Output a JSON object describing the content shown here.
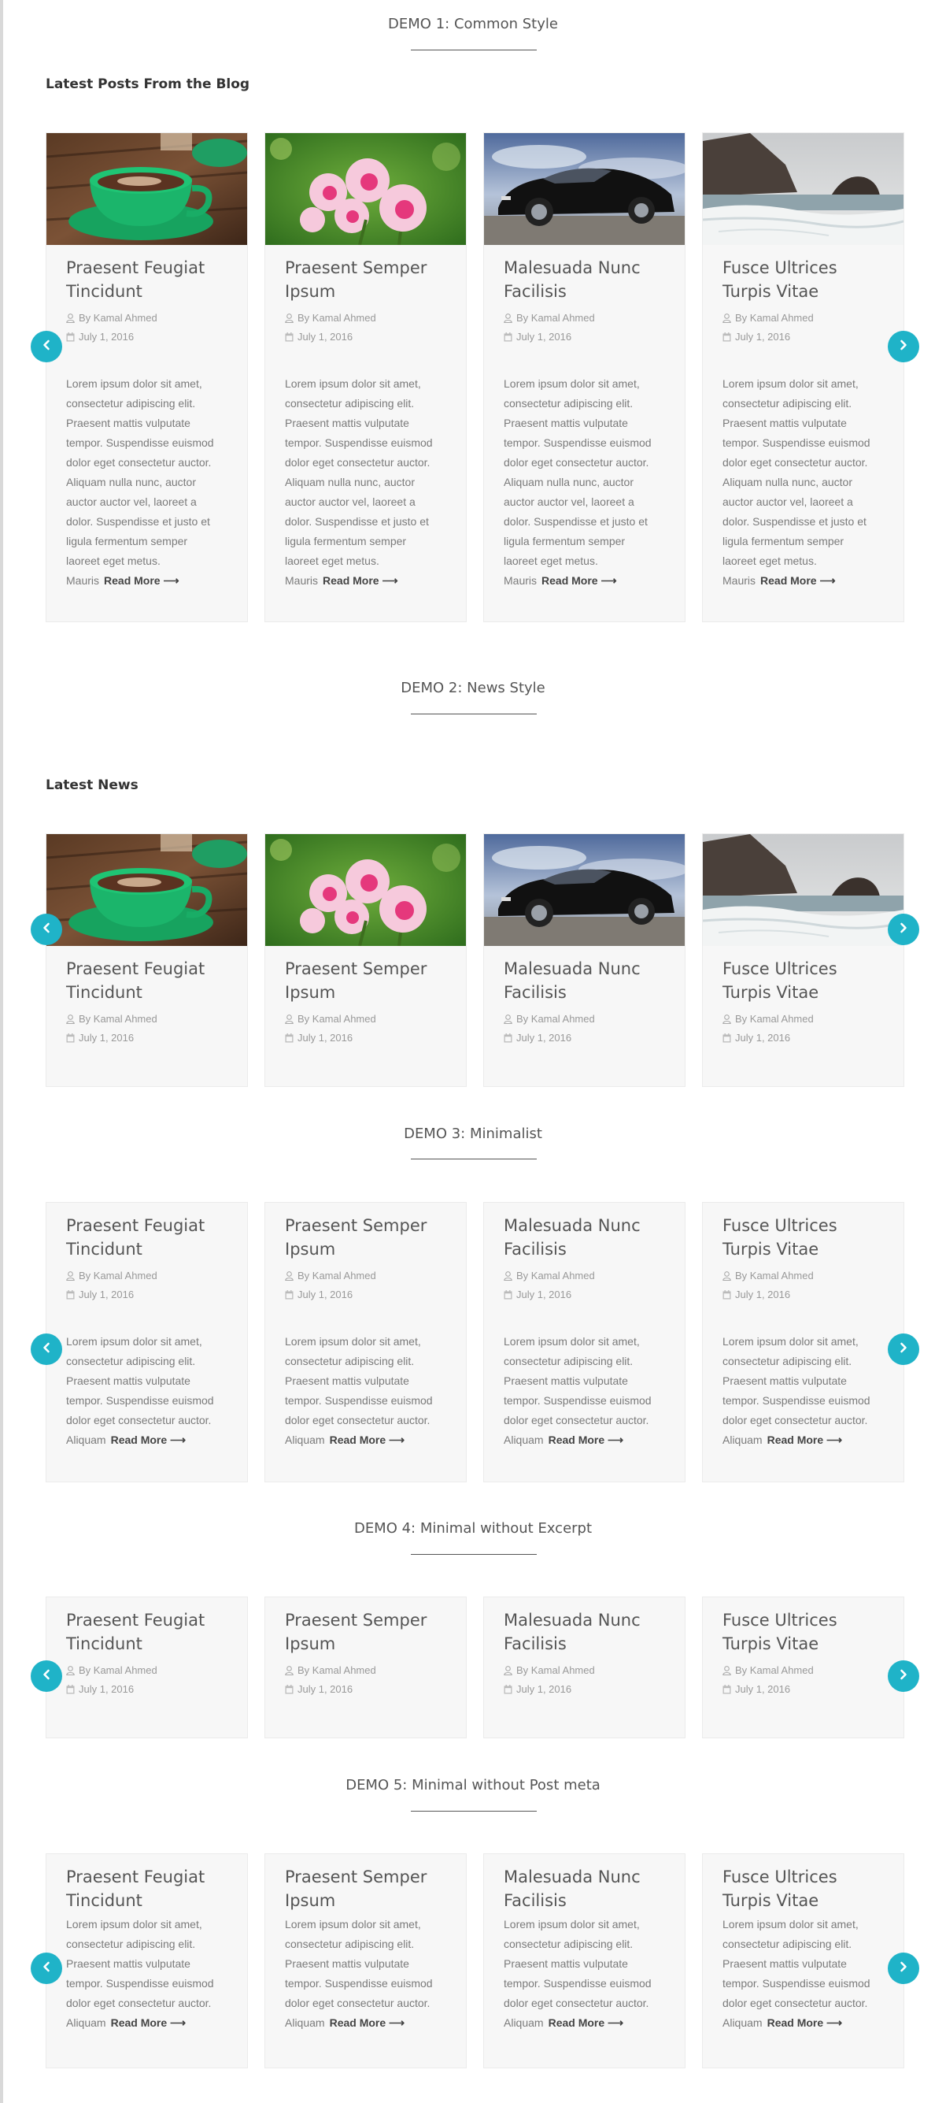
{
  "demos": [
    {
      "title": "DEMO 1: Common Style",
      "section_label": "Latest Posts From the Blog"
    },
    {
      "title": "DEMO 2: News Style",
      "section_label": "Latest News"
    },
    {
      "title": "DEMO 3: Minimalist"
    },
    {
      "title": "DEMO 4: Minimal without Excerpt"
    },
    {
      "title": "DEMO 5: Minimal without Post meta"
    }
  ],
  "posts": [
    {
      "title_line1": "Praesent Feugiat",
      "title_line2": "Tincidunt",
      "image": "coffee-cup-photo"
    },
    {
      "title_line1": "Praesent Semper",
      "title_line2": "Ipsum",
      "image": "pink-flowers-photo"
    },
    {
      "title_line1": "Malesuada Nunc",
      "title_line2": "Facilisis",
      "image": "black-sports-car-photo"
    },
    {
      "title_line1": "Fusce Ultrices",
      "title_line2": "Turpis Vitae",
      "image": "sea-rocks-photo"
    }
  ],
  "meta": {
    "author": "By Kamal Ahmed",
    "date": "July 1, 2016"
  },
  "excerpt_long": [
    "Lorem ipsum dolor sit amet,",
    "consectetur adipiscing elit.",
    "Praesent mattis vulputate",
    "tempor. Suspendisse euismod",
    "dolor eget consectetur auctor.",
    "Aliquam nulla nunc, auctor",
    "auctor auctor vel, laoreet a",
    "dolor. Suspendisse et justo et",
    "ligula fermentum semper",
    "laoreet eget metus."
  ],
  "excerpt_long_tail": "Mauris",
  "excerpt_short": [
    "Lorem ipsum dolor sit amet,",
    "consectetur adipiscing elit.",
    "Praesent mattis vulputate",
    "tempor. Suspendisse euismod",
    "dolor eget consectetur auctor."
  ],
  "excerpt_short_tail": "Aliquam",
  "read_more": "Read More ⟶",
  "nav": {
    "prev_icon": "chevron-left-icon",
    "next_icon": "chevron-right-icon"
  },
  "colors": {
    "accent": "#1fb3c8",
    "card_bg": "#f7f7f7"
  }
}
